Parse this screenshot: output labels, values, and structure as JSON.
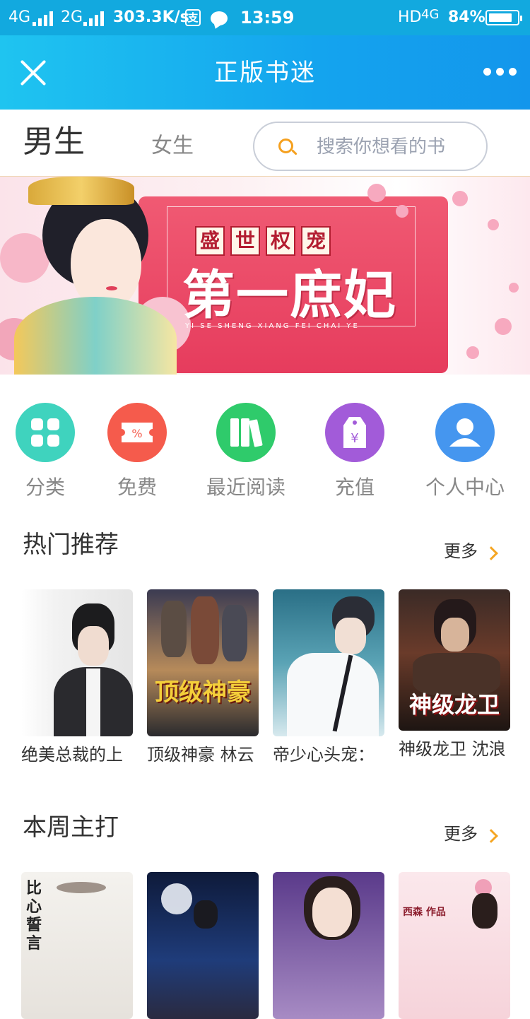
{
  "status_bar": {
    "network_1": "4G",
    "network_2": "2G",
    "speed": "303.3K/s",
    "alipay_glyph": "支",
    "time": "13:59",
    "hd": "HD",
    "network_3": "4G",
    "battery": "84%",
    "battery_level": 0.84
  },
  "title_bar": {
    "title": "正版书迷"
  },
  "tabs": {
    "male": "男生",
    "female": "女生",
    "search_placeholder": "搜索你想看的书"
  },
  "banner": {
    "subtitle_chars": [
      "盛",
      "世",
      "权",
      "宠"
    ],
    "title": "第一庶妃",
    "pinyin": "YI SE SHENG XIANG FEI CHAI YE"
  },
  "quick_menu": [
    {
      "label": "分类",
      "icon": "grid-icon",
      "color": "#3fd3be"
    },
    {
      "label": "免费",
      "icon": "ticket-icon",
      "color": "#f55b4c"
    },
    {
      "label": "最近阅读",
      "icon": "books-icon",
      "color": "#2fcb6b"
    },
    {
      "label": "充值",
      "icon": "price-tag-icon",
      "color": "#a25bd9"
    },
    {
      "label": "个人中心",
      "icon": "user-icon",
      "color": "#4596ef"
    }
  ],
  "hot": {
    "title": "热门推荐",
    "more": "更多",
    "books": [
      {
        "name": "绝美总裁的上",
        "cover_text": ""
      },
      {
        "name": "顶级神豪 林云",
        "cover_text": "顶级神豪"
      },
      {
        "name": "帝少心头宠：",
        "cover_text": ""
      },
      {
        "name": "神级龙卫 沈浪",
        "cover_text": "神级龙卫"
      }
    ]
  },
  "weekly": {
    "title": "本周主打",
    "more": "更多",
    "cover_text_1": "比心誓言",
    "cover_text_4": "西森 作品"
  }
}
